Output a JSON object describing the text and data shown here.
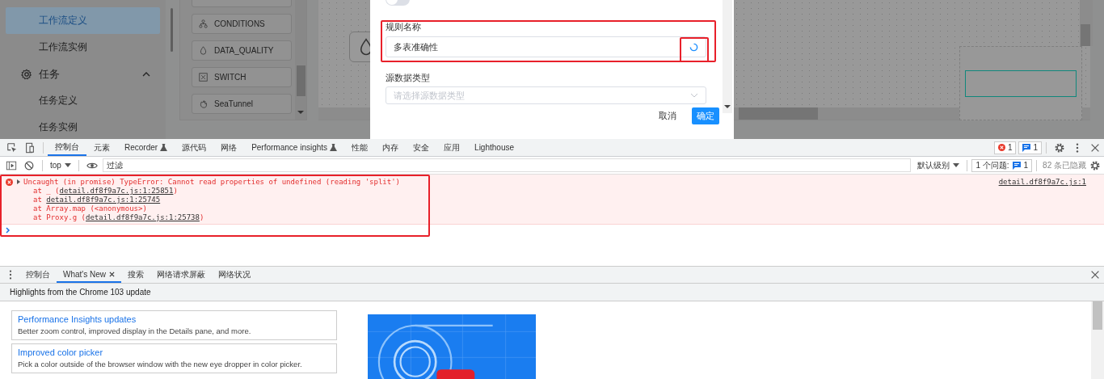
{
  "sidebar": {
    "items": [
      {
        "label": "工作流定义",
        "selected": true
      },
      {
        "label": "工作流实例",
        "selected": false
      },
      {
        "label": "任务",
        "selected": false,
        "expanded": true,
        "children": [
          {
            "label": "任务定义",
            "selected": false
          },
          {
            "label": "任务实例",
            "selected": false
          }
        ]
      }
    ]
  },
  "palette": {
    "items": [
      {
        "label": "CONDITIONS",
        "kind": "conditions"
      },
      {
        "label": "DATA_QUALITY",
        "kind": "drop"
      },
      {
        "label": "SWITCH",
        "kind": "switch"
      },
      {
        "label": "SeaTunnel",
        "kind": "hand"
      }
    ]
  },
  "dialog": {
    "toggle": {
      "on": false
    },
    "fields": [
      {
        "label": "规则名称",
        "value": "多表准确性",
        "loading": true,
        "kind": "input"
      },
      {
        "label": "源数据类型",
        "placeholder": "请选择源数据类型",
        "kind": "select"
      }
    ],
    "buttons": [
      {
        "label": "取消",
        "primary": false
      },
      {
        "label": "确定",
        "primary": true
      }
    ]
  },
  "devtools": {
    "tabs": [
      {
        "label": "控制台",
        "selected": true,
        "experimental": false
      },
      {
        "label": "元素",
        "selected": false,
        "experimental": false
      },
      {
        "label": "Recorder",
        "selected": false,
        "experimental": true
      },
      {
        "label": "源代码",
        "selected": false,
        "experimental": false
      },
      {
        "label": "网络",
        "selected": false,
        "experimental": false
      },
      {
        "label": "Performance insights",
        "selected": false,
        "experimental": true
      },
      {
        "label": "性能",
        "selected": false,
        "experimental": false
      },
      {
        "label": "内存",
        "selected": false,
        "experimental": false
      },
      {
        "label": "安全",
        "selected": false,
        "experimental": false
      },
      {
        "label": "应用",
        "selected": false,
        "experimental": false
      },
      {
        "label": "Lighthouse",
        "selected": false,
        "experimental": false
      }
    ],
    "error_count": "1",
    "message_count": "1",
    "console_toolbar": {
      "context": "top",
      "filter": {
        "placeholder": "过滤"
      },
      "levels": "默认级别",
      "issues_label": "1 个问题:",
      "issues_count": "1",
      "hidden": "82 条已隐藏"
    },
    "messages": [
      {
        "kind": "error",
        "expanded": false,
        "text": "Uncaught (in promise) TypeError: Cannot read properties of undefined (reading 'split')",
        "source": "detail.df8f9a7c.js:1",
        "stack": [
          {
            "before": "at _ (",
            "link": "detail.df8f9a7c.js:1:25851",
            "after": ")"
          },
          {
            "before": "at ",
            "link": "detail.df8f9a7c.js:1:25745"
          },
          {
            "before": "at Array.map (<anonymous>)"
          },
          {
            "before": "at Proxy.g (",
            "link": "detail.df8f9a7c.js:1:25738",
            "after": ")"
          }
        ]
      }
    ],
    "drawer": {
      "tabs": [
        {
          "label": "控制台",
          "selected": false,
          "closable": false
        },
        {
          "label": "What's New",
          "selected": true,
          "closable": true
        },
        {
          "label": "搜索",
          "selected": false,
          "closable": false
        },
        {
          "label": "网络请求屏蔽",
          "selected": false,
          "closable": false
        },
        {
          "label": "网络状况",
          "selected": false,
          "closable": false
        }
      ],
      "header": "Highlights from the Chrome 103 update",
      "cards": [
        {
          "title": "Performance Insights updates",
          "text": "Better zoom control, improved display in the Details pane, and more."
        },
        {
          "title": "Improved color picker",
          "text": "Pick a color outside of the browser window with the new eye dropper in color picker."
        }
      ]
    }
  }
}
